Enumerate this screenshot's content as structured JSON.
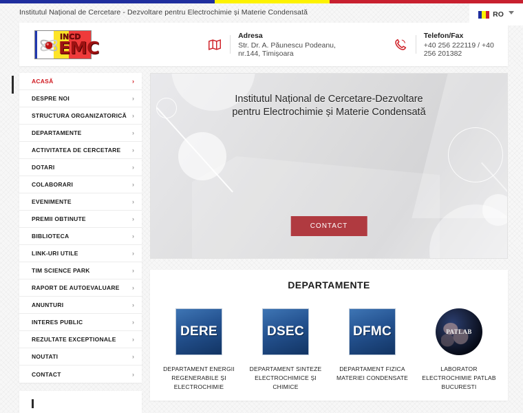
{
  "flag_strip": {
    "blue": "#1f2e9e",
    "yellow": "#fdf200",
    "red": "#c8202f"
  },
  "topbar": {
    "tagline": "Institutul Național de Cercetare - Dezvoltare pentru Electrochimie și Materie Condensată",
    "language": "RO"
  },
  "header": {
    "logo": {
      "incd": "INCD",
      "emc": "EMC"
    },
    "address": {
      "title": "Adresa",
      "value": "Str. Dr. A. Păunescu Podeanu, nr.144, Timișoara"
    },
    "phone": {
      "title": "Telefon/Fax",
      "value": "+40 256 222119 / +40 256 201382"
    }
  },
  "sidebar": {
    "items": [
      {
        "label": "ACASĂ",
        "active": true
      },
      {
        "label": "DESPRE NOI",
        "active": false
      },
      {
        "label": "STRUCTURA ORGANIZATORICĂ",
        "active": false
      },
      {
        "label": "DEPARTAMENTE",
        "active": false
      },
      {
        "label": "ACTIVITATEA DE CERCETARE",
        "active": false
      },
      {
        "label": "DOTARI",
        "active": false
      },
      {
        "label": "COLABORARI",
        "active": false
      },
      {
        "label": "EVENIMENTE",
        "active": false
      },
      {
        "label": "PREMII OBTINUTE",
        "active": false
      },
      {
        "label": "BIBLIOTECA",
        "active": false
      },
      {
        "label": "LINK-URI UTILE",
        "active": false
      },
      {
        "label": "TIM SCIENCE PARK",
        "active": false
      },
      {
        "label": "RAPORT DE AUTOEVALUARE",
        "active": false
      },
      {
        "label": "ANUNTURI",
        "active": false
      },
      {
        "label": "INTERES PUBLIC",
        "active": false
      },
      {
        "label": "REZULTATE EXCEPTIONALE",
        "active": false
      },
      {
        "label": "NOUTATI",
        "active": false
      },
      {
        "label": "CONTACT",
        "active": false
      }
    ],
    "chevron": "›",
    "active_color": "#d0181f"
  },
  "hero": {
    "title_line1": "Institutul Național de Cercetare-Dezvoltare",
    "title_line2": "pentru Electrochimie și Materie Condensată",
    "cta_label": "CONTACT",
    "cta_color": "#b03a40"
  },
  "departments": {
    "heading": "DEPARTAMENTE",
    "items": [
      {
        "acronym": "DERE",
        "type": "tile",
        "name": "DEPARTAMENT ENERGII REGENERABILE ȘI ELECTROCHIMIE"
      },
      {
        "acronym": "DSEC",
        "type": "tile",
        "name": "DEPARTAMENT SINTEZE ELECTROCHIMICE ȘI CHIMICE"
      },
      {
        "acronym": "DFMC",
        "type": "tile",
        "name": "DEPARTAMENT FIZICA MATERIEI CONDENSATE"
      },
      {
        "acronym": "PATLAB",
        "type": "globe",
        "name": "LABORATOR ELECTROCHIMIE PATLAB BUCURESTI"
      }
    ],
    "tile_color": "#245290"
  }
}
